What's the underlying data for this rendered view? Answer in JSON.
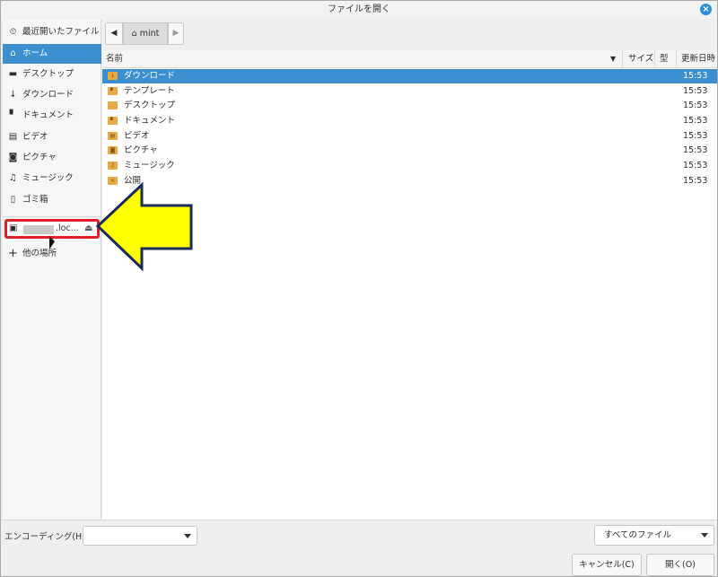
{
  "window": {
    "title": "ファイルを開く"
  },
  "sidebar": {
    "items": [
      {
        "label": "最近開いたファイル",
        "icon": "clock-icon"
      },
      {
        "label": "ホーム",
        "icon": "home-icon"
      },
      {
        "label": "デスクトップ",
        "icon": "desktop-icon"
      },
      {
        "label": "ダウンロード",
        "icon": "download-icon"
      },
      {
        "label": "ドキュメント",
        "icon": "document-icon"
      },
      {
        "label": "ビデオ",
        "icon": "video-icon"
      },
      {
        "label": "ピクチャ",
        "icon": "camera-icon"
      },
      {
        "label": "ミュージック",
        "icon": "music-icon"
      },
      {
        "label": "ゴミ箱",
        "icon": "trash-icon"
      }
    ],
    "device": {
      "label": ".loc...",
      "icon": "network-drive-icon"
    },
    "other_locations": "他の場所"
  },
  "pathbar": {
    "crumb": "mint"
  },
  "filelist": {
    "columns": {
      "name": "名前",
      "size": "サイズ",
      "type": "型",
      "modified": "更新日時"
    },
    "rows": [
      {
        "name": "ダウンロード",
        "time": "15:53"
      },
      {
        "name": "テンプレート",
        "time": "15:53"
      },
      {
        "name": "デスクトップ",
        "time": "15:53"
      },
      {
        "name": "ドキュメント",
        "time": "15:53"
      },
      {
        "name": "ビデオ",
        "time": "15:53"
      },
      {
        "name": "ピクチャ",
        "time": "15:53"
      },
      {
        "name": "ミュージック",
        "time": "15:53"
      },
      {
        "name": "公開",
        "time": "15:53"
      }
    ]
  },
  "bottom": {
    "encoding_label": "エンコーディング(H):",
    "encoding_value": "",
    "filter": "すべてのファイル",
    "cancel": "キャンセル(C)",
    "open": "開く(O)"
  },
  "colors": {
    "selection": "#3b8fd0",
    "highlight_box": "#e01e24",
    "arrow_fill": "#ffff00",
    "arrow_stroke": "#1a2a5a"
  }
}
